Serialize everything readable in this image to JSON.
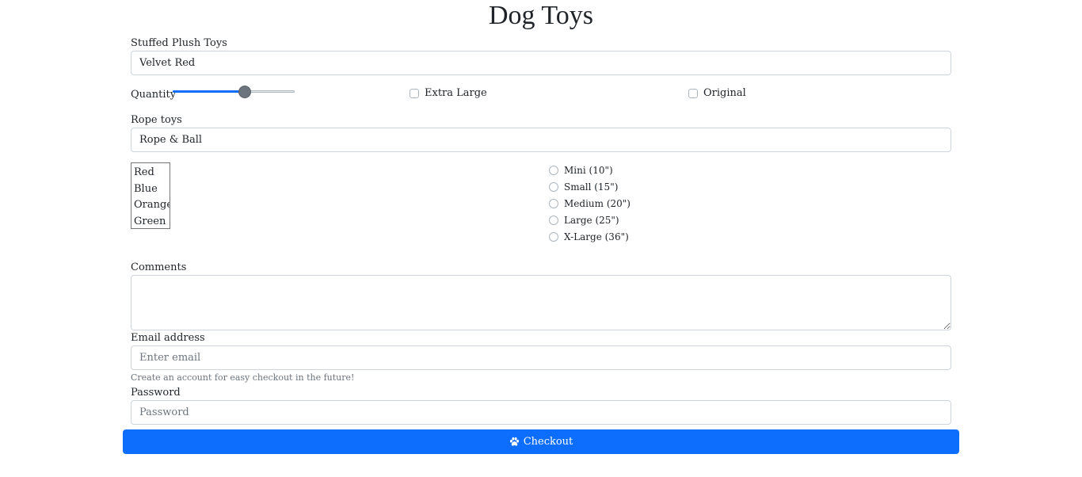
{
  "page": {
    "title": "Dog Toys"
  },
  "plush": {
    "label": "Stuffed Plush Toys",
    "value": "Velvet Red"
  },
  "quantity": {
    "label": "Quantity",
    "level_fraction": 0.59
  },
  "options": {
    "extra_large": "Extra Large",
    "original": "Original"
  },
  "rope": {
    "label": "Rope toys",
    "value": "Rope & Ball"
  },
  "colors": [
    "Red",
    "Blue",
    "Orange",
    "Green"
  ],
  "sizes": [
    "Mini (10\")",
    "Small (15\")",
    "Medium (20\")",
    "Large (25\")",
    "X-Large (36\")"
  ],
  "comments": {
    "label": "Comments",
    "value": ""
  },
  "email": {
    "label": "Email address",
    "placeholder": "Enter email",
    "help": "Create an account for easy checkout in the future!"
  },
  "password": {
    "label": "Password",
    "placeholder": "Password"
  },
  "checkout": {
    "label": "Checkout",
    "icon": "paw-icon",
    "color": "#0d6efd"
  }
}
